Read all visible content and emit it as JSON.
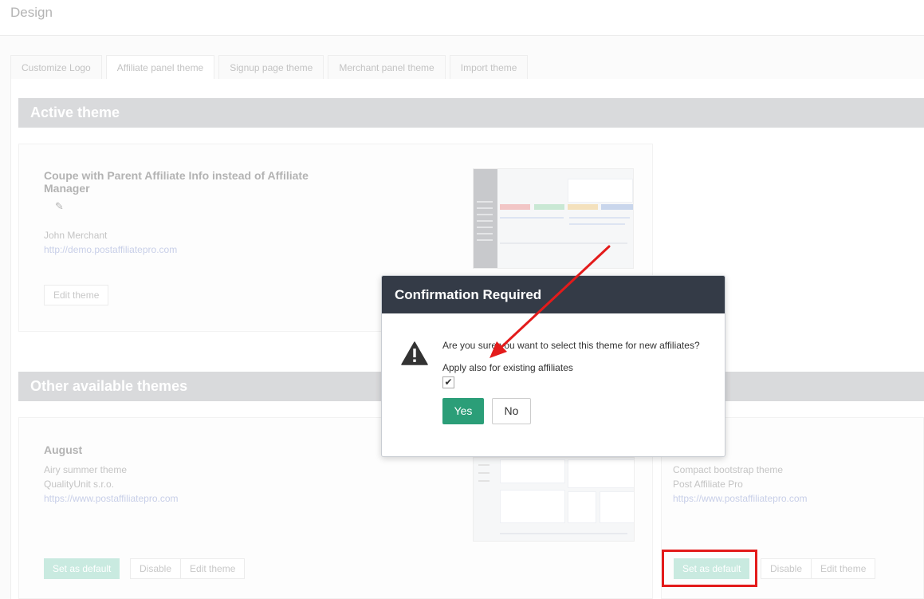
{
  "page": {
    "title": "Design"
  },
  "tabs": [
    {
      "label": "Customize Logo",
      "active": false
    },
    {
      "label": "Affiliate panel theme",
      "active": true
    },
    {
      "label": "Signup page theme",
      "active": false
    },
    {
      "label": "Merchant panel theme",
      "active": false
    },
    {
      "label": "Import theme",
      "active": false
    }
  ],
  "active_section": {
    "title": "Active theme",
    "theme": {
      "name_line1": "Coupe with Parent Affiliate Info instead of Affiliate",
      "name_line2": "Manager",
      "author": "John Merchant",
      "url": "http://demo.postaffiliatepro.com",
      "edit_label": "Edit theme"
    }
  },
  "other_section": {
    "title": "Other available themes",
    "themes": [
      {
        "name": "August",
        "description": "Airy summer theme",
        "author": "QualityUnit s.r.o.",
        "url": "https://www.postaffiliatepro.com",
        "set_default_label": "Set as default",
        "disable_label": "Disable",
        "edit_label": "Edit theme"
      },
      {
        "description": "Compact bootstrap theme",
        "author": "Post Affiliate Pro",
        "url": "https://www.postaffiliatepro.com",
        "set_default_label": "Set as default",
        "disable_label": "Disable",
        "edit_label": "Edit theme"
      }
    ]
  },
  "modal": {
    "title": "Confirmation Required",
    "icon": "warning-icon",
    "message": "Are you sure you want to select this theme for new affiliates?",
    "sub_label": "Apply also for existing affiliates",
    "checkbox_checked": true,
    "checkbox_glyph": "✔",
    "yes_label": "Yes",
    "no_label": "No"
  },
  "colors": {
    "modal_header": "#343b47",
    "yes_button": "#2b9e78",
    "annotation": "#e31b1b"
  }
}
